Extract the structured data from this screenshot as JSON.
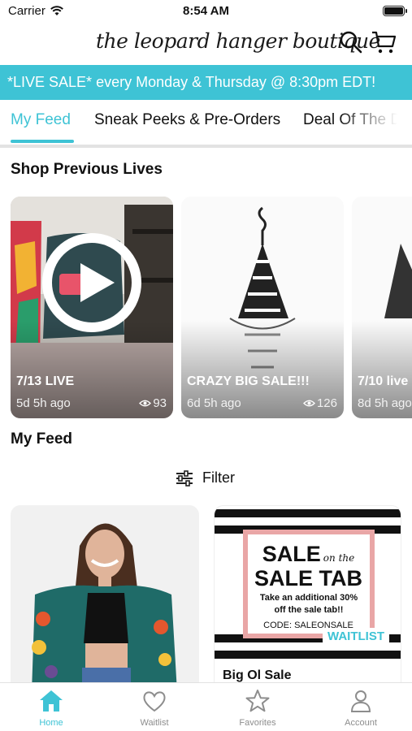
{
  "status_bar": {
    "carrier": "Carrier",
    "time": "8:54 AM"
  },
  "header": {
    "brand": "the leopard hanger boutique",
    "search_icon": "search-icon",
    "cart_icon": "cart-icon"
  },
  "banner": {
    "text": "*LIVE SALE* every Monday & Thursday @ 8:30pm EDT!",
    "color": "#3ec3d5"
  },
  "tabs": [
    {
      "label": "My Feed",
      "active": true
    },
    {
      "label": "Sneak Peeks & Pre-Orders",
      "active": false
    },
    {
      "label": "Deal Of The Day",
      "active": false
    }
  ],
  "previous_lives": {
    "title": "Shop Previous Lives",
    "items": [
      {
        "title": "7/13 LIVE",
        "ago": "5d 5h ago",
        "views": "93"
      },
      {
        "title": "CRAZY BIG SALE!!!",
        "ago": "6d 5h ago",
        "views": "126"
      },
      {
        "title": "7/10 live",
        "ago": "8d 5h ago",
        "views": ""
      }
    ]
  },
  "feed": {
    "title": "My Feed",
    "filter_label": "Filter",
    "products": [
      {
        "title": "",
        "badge": ""
      },
      {
        "title": "Big Ol Sale",
        "badge": "WAITLIST",
        "graphic": {
          "line1": "SALE",
          "line1_script": "on the",
          "line2": "SALE TAB",
          "body": "Take an additional 30% off the sale tab!!",
          "code": "CODE: SALEONSALE"
        }
      }
    ]
  },
  "bottom_nav": [
    {
      "label": "Home",
      "icon": "home-icon",
      "active": true
    },
    {
      "label": "Waitlist",
      "icon": "heart-icon",
      "active": false
    },
    {
      "label": "Favorites",
      "icon": "star-icon",
      "active": false
    },
    {
      "label": "Account",
      "icon": "person-icon",
      "active": false
    }
  ]
}
